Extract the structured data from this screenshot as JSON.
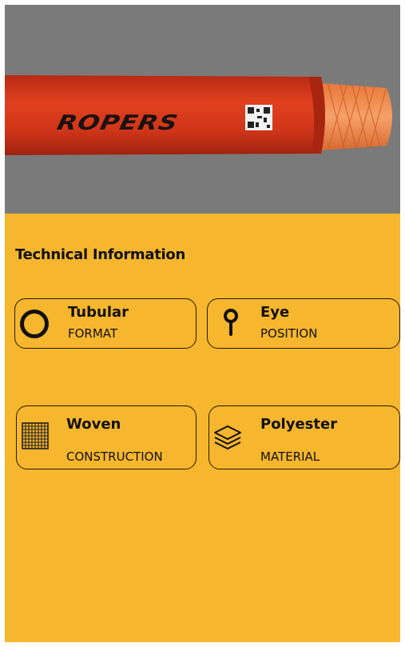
{
  "hero": {
    "brand_text": "ROPERS"
  },
  "section_title": "Technical Information",
  "specs": [
    {
      "value": "Tubular",
      "label": "FORMAT",
      "icon": "circle-icon"
    },
    {
      "value": "Eye",
      "label": "POSITION",
      "icon": "eye-loop-icon"
    },
    {
      "value": "Woven",
      "label": "CONSTRUCTION",
      "icon": "woven-grid-icon"
    },
    {
      "value": "Polyester",
      "label": "MATERIAL",
      "icon": "layers-icon"
    }
  ],
  "colors": {
    "panel": "#f6b62d",
    "hero_bg": "#7a7a7a",
    "sleeve": "#d9361c",
    "rope_core": "#f2874a"
  }
}
